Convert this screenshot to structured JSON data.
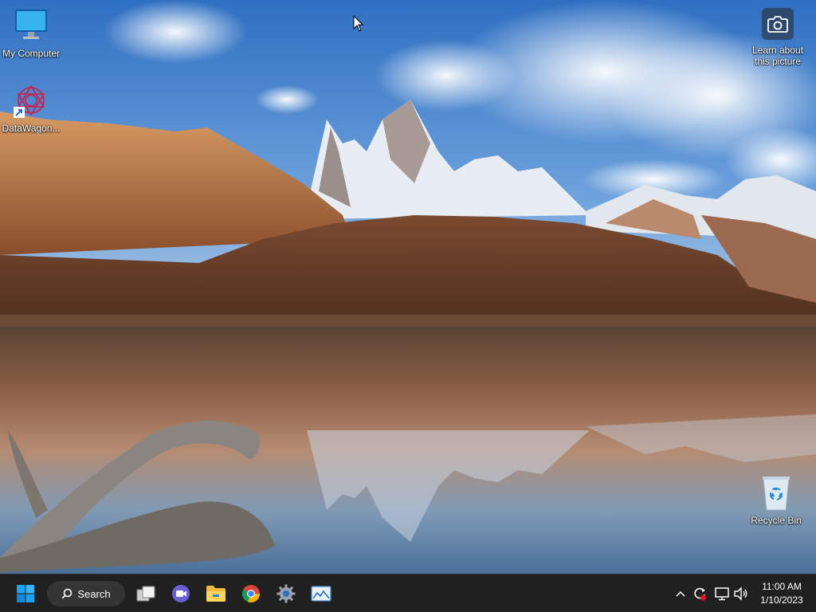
{
  "desktop": {
    "icons": [
      {
        "id": "my-computer",
        "label": "My Computer",
        "icon": "monitor-icon"
      },
      {
        "id": "datawagon",
        "label": "DataWagon...",
        "icon": "datawagon-app-icon",
        "shortcut": true
      },
      {
        "id": "recycle-bin",
        "label": "Recycle Bin",
        "icon": "recycle-bin-icon"
      }
    ],
    "spotlight": {
      "line1": "Learn about",
      "line2": "this picture",
      "icon": "camera-icon"
    }
  },
  "taskbar": {
    "start_icon": "windows-start-icon",
    "search_label": "Search",
    "apps": [
      {
        "name": "task-view",
        "icon": "task-view-icon"
      },
      {
        "name": "meet",
        "icon": "video-chat-icon"
      },
      {
        "name": "file-explorer",
        "icon": "folder-icon"
      },
      {
        "name": "chrome",
        "icon": "chrome-icon"
      },
      {
        "name": "settings",
        "icon": "gear-icon"
      },
      {
        "name": "photos",
        "icon": "image-viewer-icon"
      }
    ],
    "tray": {
      "icons": [
        "chevron-up-icon",
        "sync-icon",
        "network-icon",
        "speaker-icon"
      ],
      "time": "11:00 AM",
      "date": "1/10/2023"
    }
  },
  "colors": {
    "taskbar_bg": "#202020",
    "accent": "#0078d4"
  }
}
